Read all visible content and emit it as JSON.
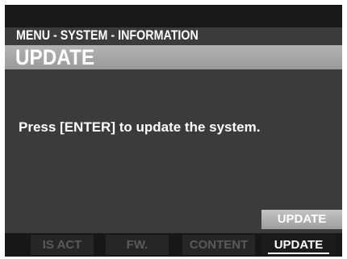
{
  "header": {
    "breadcrumb": "MENU - SYSTEM - INFORMATION",
    "title": "UPDATE"
  },
  "main": {
    "message": "Press [ENTER] to update the system."
  },
  "action_button": {
    "label": "UPDATE"
  },
  "tabs": [
    {
      "label": "IS ACT",
      "active": false
    },
    {
      "label": "FW.",
      "active": false
    },
    {
      "label": "CONTENT",
      "active": false
    },
    {
      "label": "UPDATE",
      "active": true
    }
  ],
  "colors": {
    "screen_background": "#3b3b3b",
    "title_bar": "#a8a8a8",
    "text": "#ffffff",
    "inactive_tab_text": "#5a5a5a"
  }
}
